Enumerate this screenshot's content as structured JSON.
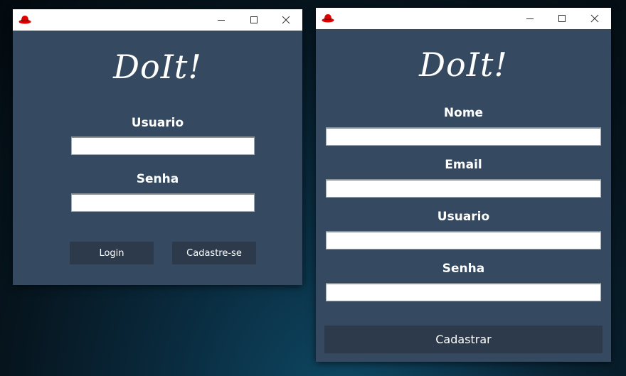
{
  "login_window": {
    "app_title": "DoIt!",
    "usuario_label": "Usuario",
    "usuario_value": "",
    "senha_label": "Senha",
    "senha_value": "",
    "login_label": "Login",
    "cadastre_label": "Cadastre-se"
  },
  "register_window": {
    "app_title": "DoIt!",
    "nome_label": "Nome",
    "nome_value": "",
    "email_label": "Email",
    "email_value": "",
    "usuario_label": "Usuario",
    "usuario_value": "",
    "senha_label": "Senha",
    "senha_value": "",
    "cadastrar_label": "Cadastrar"
  },
  "window_controls": [
    "minimize-icon",
    "maximize-icon",
    "close-icon"
  ],
  "icons": {
    "app": "red-hat-icon"
  },
  "colors": {
    "client_background": "#354a60",
    "button_background": "#2c3a4b",
    "titlebar": "#ffffff",
    "icon_red": "#e00000"
  }
}
